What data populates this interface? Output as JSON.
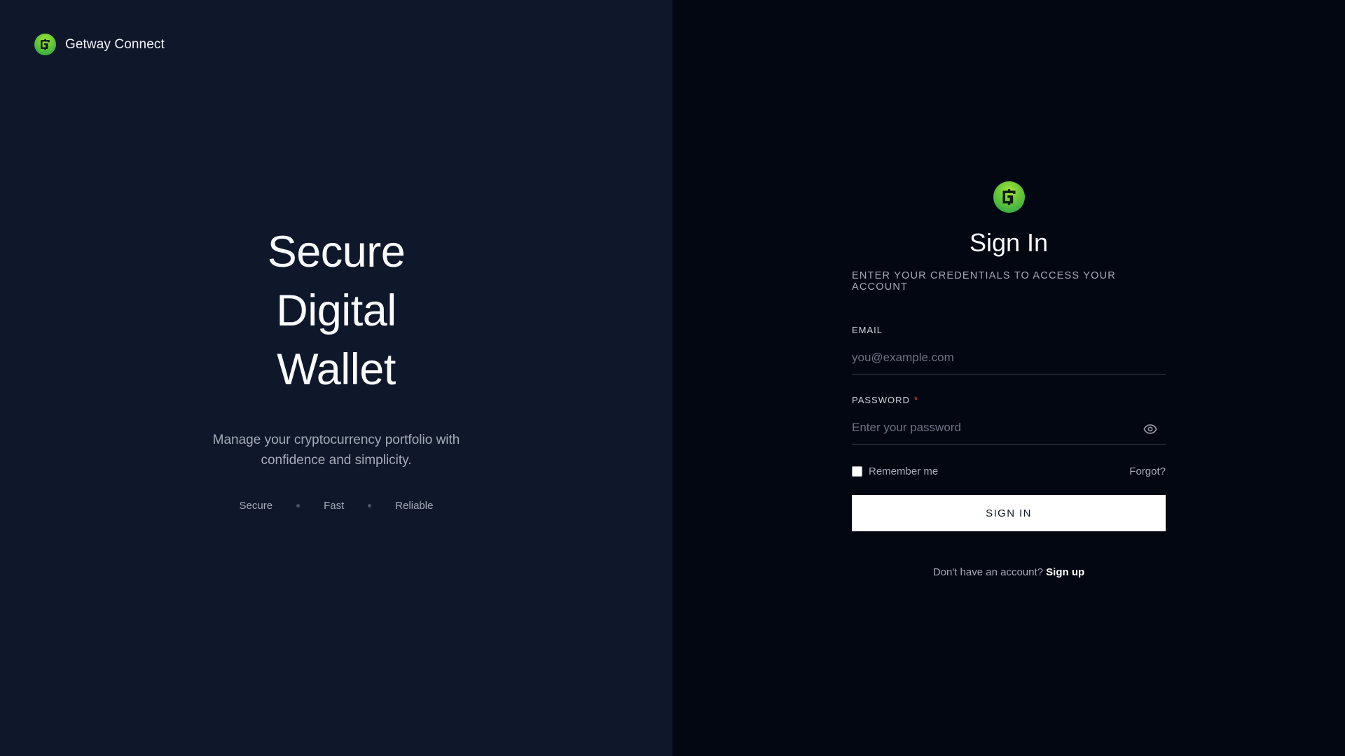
{
  "brand": {
    "name": "Getway Connect",
    "logo_icon": "gateway-logo-icon",
    "logo_colors": [
      "#a3e635",
      "#22a04a"
    ]
  },
  "hero": {
    "lines": [
      "Secure",
      "Digital",
      "Wallet"
    ],
    "subtitle": "Manage your cryptocurrency portfolio with confidence and simplicity.",
    "features": [
      "Secure",
      "Fast",
      "Reliable"
    ]
  },
  "signin": {
    "title": "Sign In",
    "subtitle": "ENTER YOUR CREDENTIALS TO ACCESS YOUR ACCOUNT",
    "email": {
      "label": "EMAIL",
      "placeholder": "you@example.com",
      "value": ""
    },
    "password": {
      "label": "PASSWORD",
      "required_mark": "*",
      "placeholder": "Enter your password",
      "value": "",
      "toggle_icon": "eye-icon"
    },
    "remember_label": "Remember me",
    "remember_checked": false,
    "forgot_label": "Forgot?",
    "submit_label": "SIGN IN",
    "signup_prompt": "Don't have an account?",
    "signup_link": "Sign up"
  },
  "colors": {
    "left_bg": "#0f172a",
    "right_bg": "#030712",
    "required": "#ef4444",
    "button_bg": "#ffffff"
  }
}
